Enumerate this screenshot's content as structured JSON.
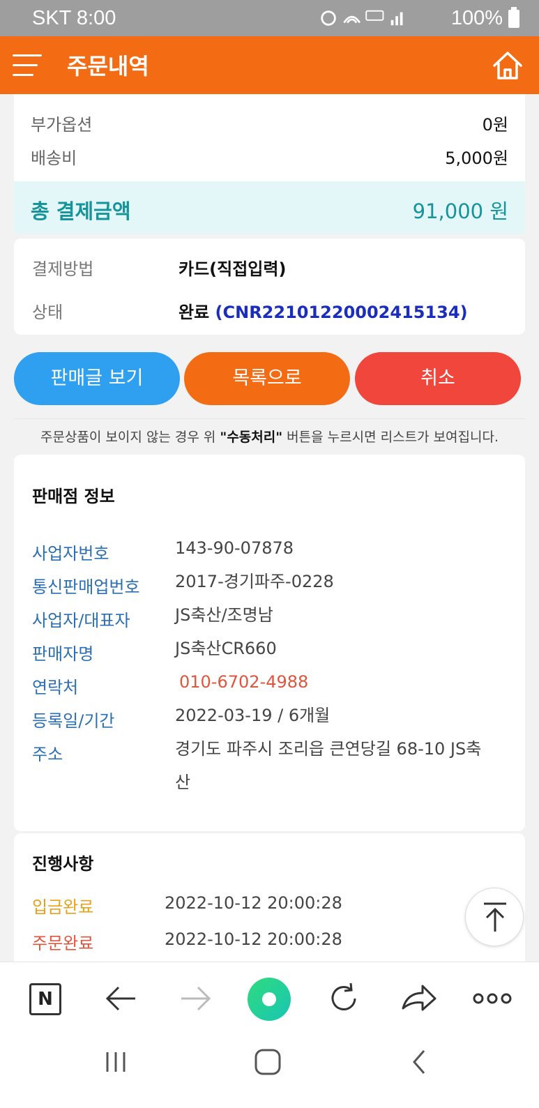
{
  "status_bar": {
    "carrier_time": "SKT 8:00",
    "battery": "100%"
  },
  "app_bar": {
    "title": "주문내역",
    "menu_icon": "hamburger-menu-icon",
    "home_icon": "home-icon"
  },
  "summary": {
    "option_label": "부가옵션",
    "option_value": "0원",
    "shipping_label": "배송비",
    "shipping_value": "5,000원",
    "total_label": "총 결제금액",
    "total_value": "91,000 원"
  },
  "payment": {
    "method_label": "결제방법",
    "method_value": "카드(직접입력)",
    "status_label": "상태",
    "status_value": "완료",
    "status_code": "(CNR22101220002415134)"
  },
  "buttons": {
    "view_post": "판매글 보기",
    "to_list": "목록으로",
    "cancel": "취소"
  },
  "notice": {
    "prefix": "주문상품이 보이지 않는 경우 위 ",
    "highlight": "\"수동처리\"",
    "suffix": " 버튼을 누르시면 리스트가 보여집니다."
  },
  "seller": {
    "heading": "판매점 정보",
    "items": [
      {
        "label": "사업자번호",
        "value": "143-90-07878"
      },
      {
        "label": "통신판매업번호",
        "value": "2017-경기파주-0228"
      },
      {
        "label": "사업자/대표자",
        "value": "JS축산/조명남"
      },
      {
        "label": "판매자명",
        "value": "JS축산CR660"
      },
      {
        "label": "연락처",
        "value": "010-6702-4988"
      },
      {
        "label": "등록일/기간",
        "value": "2022-03-19 / 6개월"
      },
      {
        "label": "주소",
        "value": "경기도 파주시 조리읍 큰연당길 68-10 JS축산"
      }
    ]
  },
  "progress": {
    "heading": "진행사항",
    "items": [
      {
        "label": "입금완료",
        "value": "2022-10-12 20:00:28",
        "color": "#e6a31a"
      },
      {
        "label": "주문완료",
        "value": "2022-10-12 20:00:28",
        "color": "#e0553d"
      }
    ]
  },
  "browser_bar": {
    "n_label": "N"
  },
  "colors": {
    "accent": "#f36c14",
    "teal": "#15949c",
    "blue_btn": "#2fa0ef",
    "red_btn": "#f0463c"
  }
}
